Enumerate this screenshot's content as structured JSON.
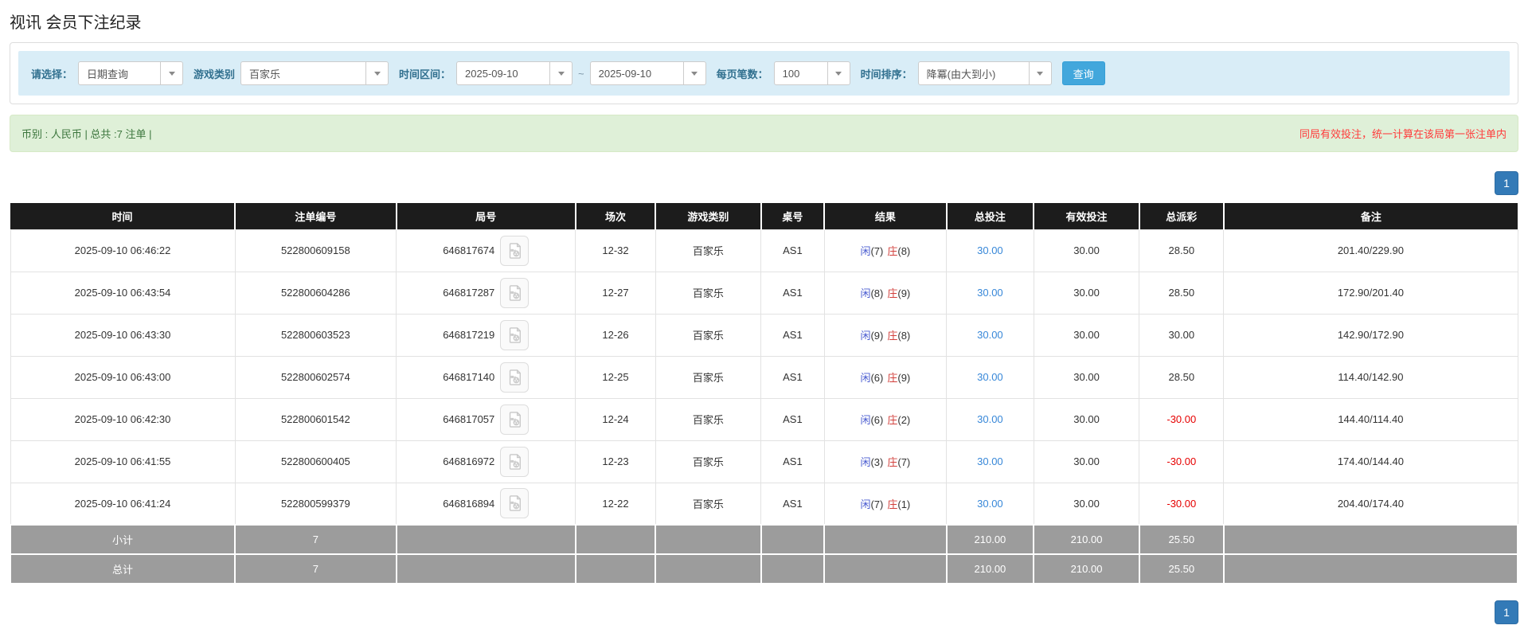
{
  "page": {
    "title": "视讯 会员下注纪录"
  },
  "colors": {
    "accent_blue": "#337ab7",
    "link_blue": "#3787d8",
    "filter_bar_bg": "#d9edf7",
    "filter_label": "#31708f",
    "search_btn": "#42a7dc",
    "alert_bg": "#dff0d8",
    "alert_text": "#3c763d",
    "notice_red": "#ff3b3b",
    "header_bg": "#1c1c1c",
    "summary_bg": "#9c9c9c",
    "player_blue": "#4a5cd0",
    "banker_red": "#d2403c",
    "negative_red": "#e60000"
  },
  "filters": {
    "select_label": "请选择：",
    "select_value": "日期查询",
    "game_type_label": "游戏类别",
    "game_type_value": "百家乐",
    "time_range_label": "时间区间：",
    "date_from": "2025-09-10",
    "range_separator": "~",
    "date_to": "2025-09-10",
    "page_size_label": "每页笔数：",
    "page_size_value": "100",
    "sort_label": "时间排序：",
    "sort_value": "降冪(由大到小)",
    "search_button": "查询"
  },
  "summary_bar": {
    "left_text": "币别 : 人民币 | 总共 :7 注单 |",
    "right_notice": "同局有效投注，统一计算在该局第一张注单内"
  },
  "pagination": {
    "page": "1"
  },
  "table": {
    "columns": [
      "时间",
      "注单编号",
      "局号",
      "场次",
      "游戏类别",
      "桌号",
      "结果",
      "总投注",
      "有效投注",
      "总派彩",
      "备注"
    ],
    "rows": [
      {
        "time": "2025-09-10 06:46:22",
        "bet_id": "522800609158",
        "round_id": "646817674",
        "session": "12-32",
        "game": "百家乐",
        "table_no": "AS1",
        "player_label": "闲",
        "player_score": "(7)",
        "banker_label": "庄",
        "banker_score": "(8)",
        "total_bet": "30.00",
        "valid_bet": "30.00",
        "payout": "28.50",
        "remark": "201.40/229.90"
      },
      {
        "time": "2025-09-10 06:43:54",
        "bet_id": "522800604286",
        "round_id": "646817287",
        "session": "12-27",
        "game": "百家乐",
        "table_no": "AS1",
        "player_label": "闲",
        "player_score": "(8)",
        "banker_label": "庄",
        "banker_score": "(9)",
        "total_bet": "30.00",
        "valid_bet": "30.00",
        "payout": "28.50",
        "remark": "172.90/201.40"
      },
      {
        "time": "2025-09-10 06:43:30",
        "bet_id": "522800603523",
        "round_id": "646817219",
        "session": "12-26",
        "game": "百家乐",
        "table_no": "AS1",
        "player_label": "闲",
        "player_score": "(9)",
        "banker_label": "庄",
        "banker_score": "(8)",
        "total_bet": "30.00",
        "valid_bet": "30.00",
        "payout": "30.00",
        "remark": "142.90/172.90"
      },
      {
        "time": "2025-09-10 06:43:00",
        "bet_id": "522800602574",
        "round_id": "646817140",
        "session": "12-25",
        "game": "百家乐",
        "table_no": "AS1",
        "player_label": "闲",
        "player_score": "(6)",
        "banker_label": "庄",
        "banker_score": "(9)",
        "total_bet": "30.00",
        "valid_bet": "30.00",
        "payout": "28.50",
        "remark": "114.40/142.90"
      },
      {
        "time": "2025-09-10 06:42:30",
        "bet_id": "522800601542",
        "round_id": "646817057",
        "session": "12-24",
        "game": "百家乐",
        "table_no": "AS1",
        "player_label": "闲",
        "player_score": "(6)",
        "banker_label": "庄",
        "banker_score": "(2)",
        "total_bet": "30.00",
        "valid_bet": "30.00",
        "payout": "-30.00",
        "remark": "144.40/114.40"
      },
      {
        "time": "2025-09-10 06:41:55",
        "bet_id": "522800600405",
        "round_id": "646816972",
        "session": "12-23",
        "game": "百家乐",
        "table_no": "AS1",
        "player_label": "闲",
        "player_score": "(3)",
        "banker_label": "庄",
        "banker_score": "(7)",
        "total_bet": "30.00",
        "valid_bet": "30.00",
        "payout": "-30.00",
        "remark": "174.40/144.40"
      },
      {
        "time": "2025-09-10 06:41:24",
        "bet_id": "522800599379",
        "round_id": "646816894",
        "session": "12-22",
        "game": "百家乐",
        "table_no": "AS1",
        "player_label": "闲",
        "player_score": "(7)",
        "banker_label": "庄",
        "banker_score": "(1)",
        "total_bet": "30.00",
        "valid_bet": "30.00",
        "payout": "-30.00",
        "remark": "204.40/174.40"
      }
    ],
    "subtotal": {
      "label": "小计",
      "count": "7",
      "total_bet": "210.00",
      "valid_bet": "210.00",
      "payout": "25.50"
    },
    "total": {
      "label": "总计",
      "count": "7",
      "total_bet": "210.00",
      "valid_bet": "210.00",
      "payout": "25.50"
    }
  }
}
